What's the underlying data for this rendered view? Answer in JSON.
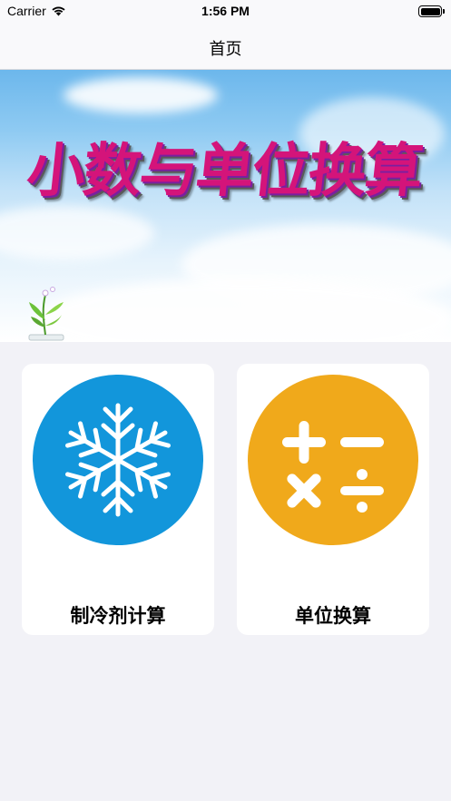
{
  "status_bar": {
    "carrier": "Carrier",
    "time": "1:56 PM",
    "wifi_icon": "wifi-icon",
    "battery_icon": "battery-icon"
  },
  "nav": {
    "title": "首页"
  },
  "banner": {
    "title": "小数与单位换算",
    "decoration_icon": "plant-icon"
  },
  "cards": [
    {
      "label": "制冷剂计算",
      "icon": "snowflake-icon",
      "color": "#1296db"
    },
    {
      "label": "单位换算",
      "icon": "calculator-icon",
      "color": "#f0a91b"
    }
  ],
  "colors": {
    "background": "#f2f2f7",
    "nav_background": "#f9f9fb",
    "card_background": "#ffffff"
  }
}
